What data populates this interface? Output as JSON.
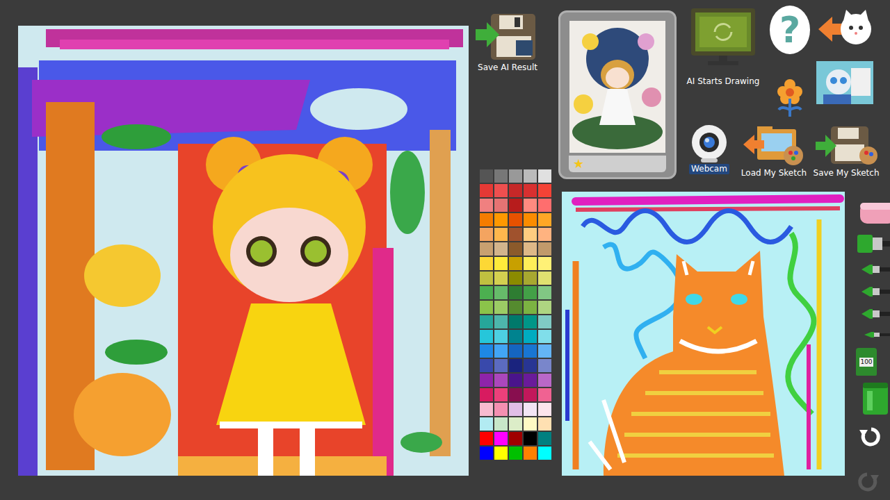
{
  "ai_result": {
    "save_label": "Save AI Result"
  },
  "gallery_card": {
    "star": "★"
  },
  "actions": {
    "ai_start": "AI Starts Drawing",
    "help": "?",
    "webcam": "Webcam",
    "load_sketch": "Load My Sketch",
    "save_sketch": "Save My Sketch"
  },
  "palette": {
    "colors": [
      "#555555",
      "#777777",
      "#999999",
      "#bbbbbb",
      "#e0e0e0",
      "#e53935",
      "#ef4f4f",
      "#c62828",
      "#d83030",
      "#f44336",
      "#f08080",
      "#e57373",
      "#b71c1c",
      "#ff8a80",
      "#ff6e6e",
      "#f57c00",
      "#ff9800",
      "#e65100",
      "#fb8c00",
      "#ffa726",
      "#f4a460",
      "#ffb74d",
      "#a0522d",
      "#ffcc80",
      "#ffb380",
      "#c8a070",
      "#d2b48c",
      "#8b5a2b",
      "#deb887",
      "#c19a6b",
      "#fdd835",
      "#ffeb3b",
      "#c8a000",
      "#ffee58",
      "#fff176",
      "#c0c040",
      "#d4d050",
      "#8b8b00",
      "#a8a830",
      "#e0e070",
      "#4caf50",
      "#66bb6a",
      "#2e7d32",
      "#43a047",
      "#81c784",
      "#8bc34a",
      "#9ccc65",
      "#558b2f",
      "#7cb342",
      "#aed581",
      "#26a69a",
      "#4db6ac",
      "#00796b",
      "#009688",
      "#80cbc4",
      "#26c6da",
      "#4dd0e1",
      "#00838f",
      "#00acc1",
      "#80deea",
      "#1e88e5",
      "#42a5f5",
      "#1565c0",
      "#1976d2",
      "#64b5f6",
      "#3949ab",
      "#5c6bc0",
      "#1a237e",
      "#283593",
      "#7986cb",
      "#8e24aa",
      "#ab47bc",
      "#4a148c",
      "#6a1b9a",
      "#ba68c8",
      "#d81b60",
      "#ec407a",
      "#880e4f",
      "#c2185b",
      "#f06292",
      "#f8bbd0",
      "#f48fb1",
      "#e1bee7",
      "#f3e5f5",
      "#fce4ec",
      "#b2ebf2",
      "#c8e6c9",
      "#dcedc8",
      "#fff9c4",
      "#ffe0b2",
      "#ff0000",
      "#ff00ff",
      "#a00000",
      "#000000",
      "#008080",
      "#0000ff",
      "#ffff00",
      "#00c000",
      "#ff8000",
      "#00ffff"
    ]
  },
  "tools": [
    {
      "kind": "eraser"
    },
    {
      "kind": "roller"
    },
    {
      "kind": "brush"
    },
    {
      "kind": "brush"
    },
    {
      "kind": "brush"
    },
    {
      "kind": "pen"
    },
    {
      "kind": "tube",
      "label": "100"
    },
    {
      "kind": "bucket"
    }
  ],
  "history": {
    "undo_disabled": false,
    "redo_disabled": true
  }
}
